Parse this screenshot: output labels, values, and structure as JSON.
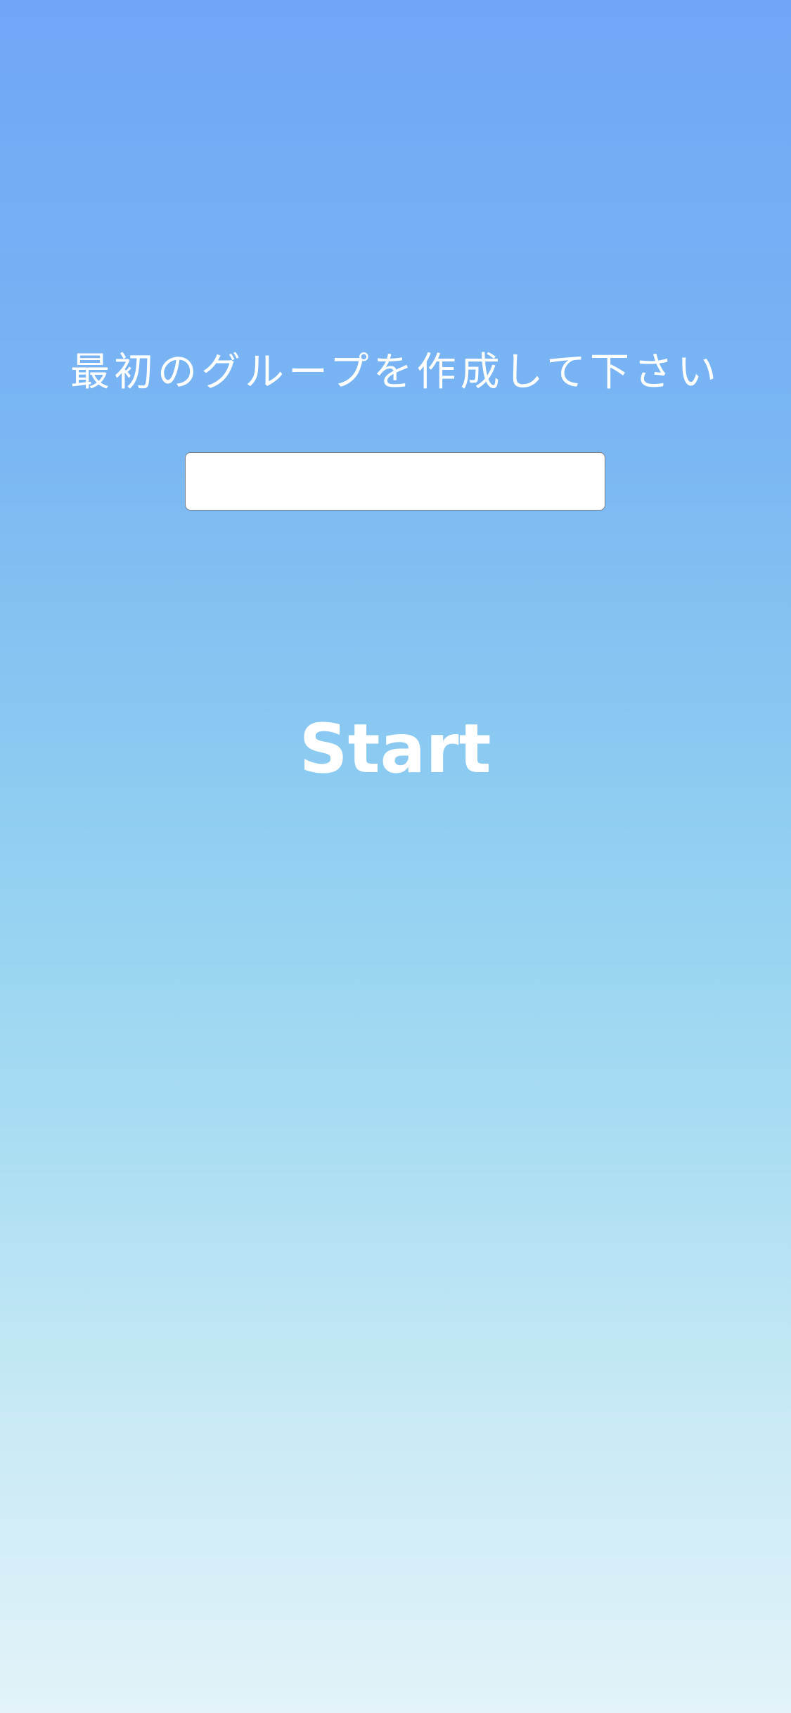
{
  "onboarding": {
    "prompt": "最初のグループを作成して下さい",
    "group_name_input": {
      "value": "",
      "placeholder": ""
    },
    "start_label": "Start"
  },
  "colors": {
    "background_top": "#71a6f7",
    "background_bottom": "#e3f3f9",
    "text": "#ffffff",
    "input_background": "#ffffff",
    "input_border": "#7a7f86"
  }
}
